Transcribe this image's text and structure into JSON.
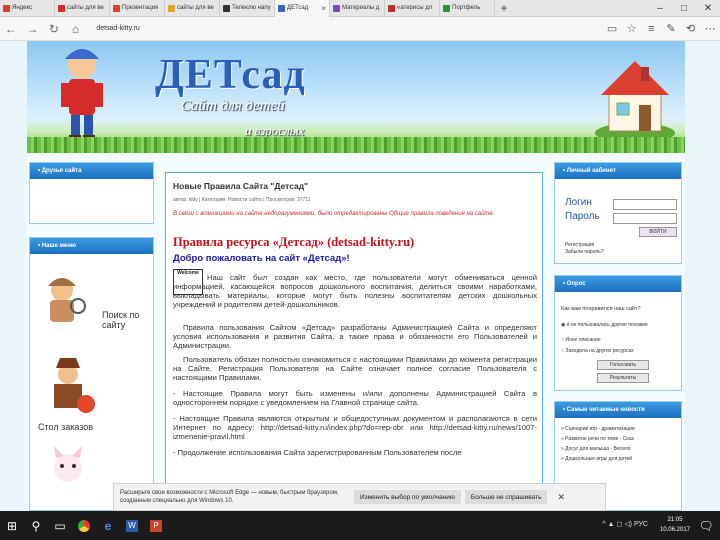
{
  "browser": {
    "tabs": [
      {
        "label": "Яндекс",
        "color": "#e23a2c"
      },
      {
        "label": "сайты для ве",
        "color": "#d9282e"
      },
      {
        "label": "Презентация",
        "color": "#d94030"
      },
      {
        "label": "сайты для ве",
        "color": "#e8a020"
      },
      {
        "label": "Телеклю напу",
        "color": "#333333"
      },
      {
        "label": "ДЕТсад",
        "color": "#3a63c4"
      },
      {
        "label": "Материалы д",
        "color": "#7b4bb0"
      },
      {
        "label": "«атерисы дл",
        "color": "#c22d2d"
      },
      {
        "label": "Портфель",
        "color": "#2f8f3a"
      }
    ],
    "active_tab_index": 5,
    "url": "detsad-kitty.ru"
  },
  "banner": {
    "title": "ДЕТсад",
    "subtitle1": "Сайт для детей",
    "subtitle2": "и взрослых"
  },
  "left": {
    "block1_title": "• Друзья сайта",
    "block2_title": "• Наше меню",
    "items": [
      "Поиск по сайту",
      "Стол заказов"
    ]
  },
  "main": {
    "heading": "Новые Правила Сайта \"Детсад\"",
    "meta": "автор: kitty  |  Категория: Новости сайта  |  Просмотров: 37711",
    "note": "В связи с возникшими на сайте недоразумениями, были отредактированы Общие правила поведения на сайте.",
    "rules_title": "Правила ресурса «Детсад» (detsad-kitty.ru)",
    "welcome": "Добро пожаловать на сайт «Детсад»!",
    "paragraphs": [
      "Наш сайт был создан как место, где пользователи могут обмениваться ценной информацией, касающейся вопросов дошкольного воспитания, делиться своими наработками, выкладывать материалы, которые могут быть полезны воспитателям детских дошкольных учреждений и родителям детей-дошкольников.",
      "Правила пользования Сайтом «Детсад» разработаны Администрацией Сайта и определяют условия использования и развития Сайта, а также права и обязанности его Пользователей и Администрации.",
      "Пользователь обязан полностью ознакомиться с настоящими Правилами до момента регистрации на Сайте. Регистрация Пользователя на Сайте означает полное согласие Пользователя с настоящими Правилами.",
      "- Настоящие Правила могут быть изменены и/или дополнены Администрацией Сайта в одностороннем порядке с уведомлением на Главной странице сайта.",
      "- Настоящие Правила являются открытым и общедоступным документом и располагаются в сети Интернет по адресу: http://detsad-kitty.ru/index.php?do=rep-obr или http://detsad-kitty.ru/news/1007-izmenenie-pravil.html",
      "- Продолжение использования Сайта зарегистрированным Пользователем после"
    ],
    "welcome_badge": "Welcome"
  },
  "right": {
    "login_title": "• Личный кабинет",
    "login_label": "Логин",
    "password_label": "Пароль",
    "login_button": "ВОЙТИ",
    "register_text": "Регистрация",
    "forgot_text": "Забыли пароль?",
    "poll_title": "• Опрос",
    "poll_question": "Как вам понравился наш сайт?",
    "poll_options": [
      "я не пользовалась другие похожие",
      "Иное описание",
      "Заходила на других ресурсах"
    ],
    "poll_button": "Голосовать",
    "poll_results": "Результаты",
    "popular_title": "• Самые читаемые новости",
    "popular_items": [
      "» Сценарии игр - драматизации",
      "» Развитие речи по теме - Сказ",
      "» Досуг для малыша - Весело",
      "» Дошкольные игры для детей"
    ]
  },
  "notification": {
    "text": "Расширьте свои возможности с Microsoft Edge — новым, быстрым браузером, созданным специально для Windows 10.",
    "button1": "Изменить выбор по умолчанию",
    "button2": "Больше не спрашивать",
    "close": "✕"
  },
  "taskbar": {
    "lang": "РУС",
    "time": "21:05",
    "date": "10.06.2017"
  }
}
